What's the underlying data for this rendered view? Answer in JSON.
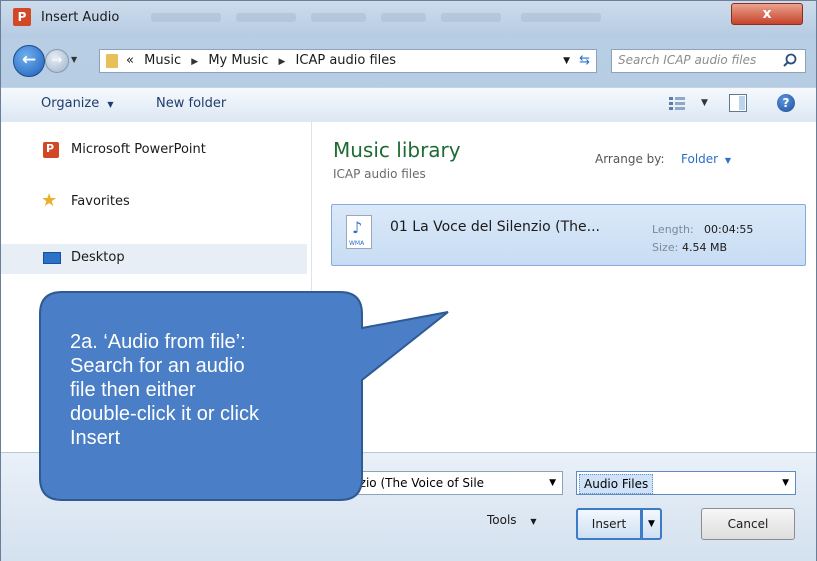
{
  "window": {
    "title": "Insert Audio",
    "close_label": "x"
  },
  "nav": {
    "back_glyph": "←",
    "forward_glyph": "→",
    "crumbs": [
      "«",
      "Music",
      "My Music",
      "ICAP audio files"
    ],
    "search_placeholder": "Search ICAP audio files"
  },
  "toolbar": {
    "organize": "Organize",
    "new_folder": "New folder"
  },
  "sidebar": {
    "items": [
      {
        "label": "Microsoft PowerPoint",
        "icon": "powerpoint-icon"
      },
      {
        "label": "Favorites",
        "icon": "star-icon"
      },
      {
        "label": "Desktop",
        "icon": "desktop-icon",
        "selected": true
      }
    ]
  },
  "main": {
    "library_title": "Music library",
    "library_subtitle": "ICAP audio files",
    "arrange_label": "Arrange by:",
    "arrange_value": "Folder",
    "file": {
      "name": "01 La Voce del Silenzio (The...",
      "length_label": "Length:",
      "length_value": "00:04:55",
      "size_label": "Size:",
      "size_value": "4.54 MB"
    }
  },
  "bottom": {
    "filename_value": "ilenzio (The Voice of Sile",
    "filetype_value": "Audio Files",
    "tools_label": "Tools",
    "insert_label": "Insert",
    "cancel_label": "Cancel"
  },
  "callout": {
    "lines": [
      "2a. ‘Audio from file’:",
      "Search for an audio",
      "file then either",
      "double-click it or click",
      "Insert"
    ],
    "fill": "#4a7ec6",
    "stroke": "#2f5a93"
  }
}
